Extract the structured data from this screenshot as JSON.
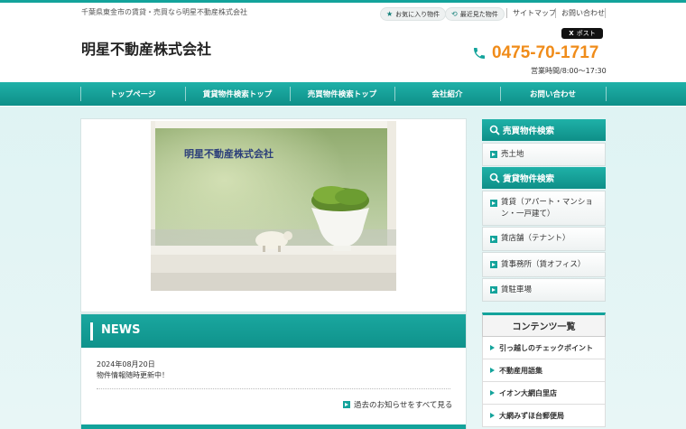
{
  "header": {
    "tagline": "千葉県東金市の賃貸・売買なら明星不動産株式会社",
    "site_title": "明星不動産株式会社",
    "favorites": "お気に入り物件",
    "recent": "最近見た物件",
    "sitemap": "サイトマップ",
    "contact": "お問い合わせ",
    "x_post": "ポスト",
    "phone": "0475-70-1717",
    "hours": "営業時間/8:00～17:30"
  },
  "nav": {
    "items": [
      {
        "label": "トップページ"
      },
      {
        "label": "賃貸物件検索トップ"
      },
      {
        "label": "売買物件検索トップ"
      },
      {
        "label": "会社紹介"
      },
      {
        "label": "お問い合わせ"
      }
    ]
  },
  "hero": {
    "title": "明星不動産株式会社"
  },
  "news": {
    "heading": "NEWS",
    "items": [
      {
        "date": "2024年08月20日",
        "text": "物件情報随時更新中！"
      }
    ],
    "more_link": "過去のお知らせをすべて見る"
  },
  "sidebar": {
    "sale_heading": "売買物件検索",
    "sale_items": [
      {
        "label": "売土地"
      }
    ],
    "rent_heading": "賃貸物件検索",
    "rent_items": [
      {
        "label": "賃貸（アパート・マンション・一戸建て）"
      },
      {
        "label": "賃店舗（テナント）"
      },
      {
        "label": "賃事務所（賃オフィス）"
      },
      {
        "label": "賃駐車場"
      }
    ],
    "contents_heading": "コンテンツ一覧",
    "contents_items": [
      {
        "label": "引っ越しのチェックポイント"
      },
      {
        "label": "不動産用語集"
      },
      {
        "label": "イオン大網白里店"
      },
      {
        "label": "大網みずほ台郵便局"
      }
    ]
  },
  "colors": {
    "brand_teal": "#13a39b",
    "phone_orange": "#f08c1a"
  },
  "icons": {
    "favorites": "star-icon",
    "recent": "history-icon",
    "phone": "phone-icon",
    "search": "search-icon"
  }
}
